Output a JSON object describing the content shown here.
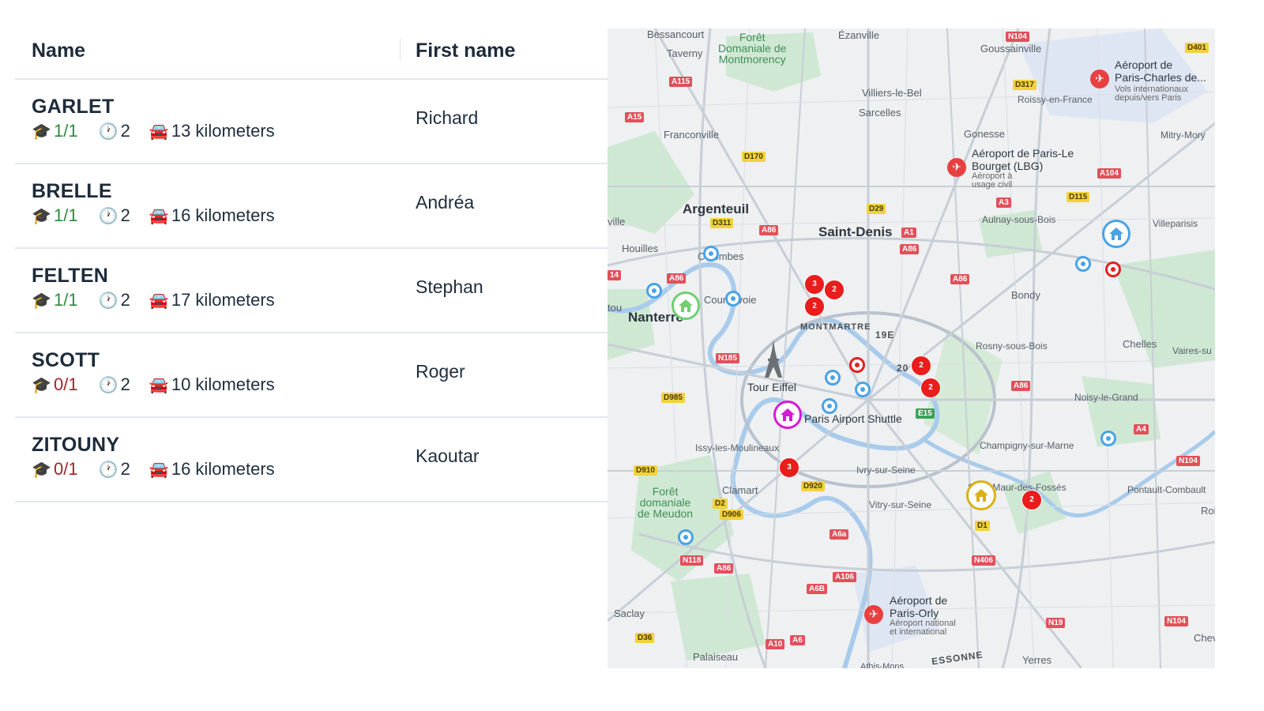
{
  "table": {
    "headers": {
      "name": "Name",
      "first_name": "First name"
    },
    "icons": {
      "grade": "graduation-cap-icon",
      "wait": "clock-icon",
      "distance": "car-icon"
    },
    "rows": [
      {
        "last_name": "GARLET",
        "first_name": "Richard",
        "grade": "1/1",
        "grade_status": "ok",
        "wait": "2",
        "distance": "13 kilometers"
      },
      {
        "last_name": "BRELLE",
        "first_name": "Andréa",
        "grade": "1/1",
        "grade_status": "ok",
        "wait": "2",
        "distance": "16 kilometers"
      },
      {
        "last_name": "FELTEN",
        "first_name": "Stephan",
        "grade": "1/1",
        "grade_status": "ok",
        "wait": "2",
        "distance": "17 kilometers"
      },
      {
        "last_name": "SCOTT",
        "first_name": "Roger",
        "grade": "0/1",
        "grade_status": "ko",
        "wait": "2",
        "distance": "10 kilometers"
      },
      {
        "last_name": "ZITOUNY",
        "first_name": "Kaoutar",
        "grade": "0/1",
        "grade_status": "ko",
        "wait": "2",
        "distance": "16 kilometers"
      }
    ],
    "colors": {
      "ok": "#2f8a3c",
      "ko": "#a0252b"
    }
  },
  "map": {
    "places": {
      "bessancourt": "Bessancourt",
      "taverny": "Taverny",
      "foret_montmorency": "Forêt\nDomaniale de\nMontmorency",
      "ezanville": "Ézanville",
      "goussainville": "Goussainville",
      "cdg": "Aéroport de\nParis-Charles de...",
      "cdg_sub": "Vols internationaux\ndepuis/vers Paris",
      "roissy": "Roissy-en-France",
      "villiers": "Villiers-le-Bel",
      "sarcelles": "Sarcelles",
      "franconville": "Franconville",
      "gonesse": "Gonesse",
      "mitry": "Mitry-Mory",
      "bourget": "Aéroport de Paris-Le\nBourget (LBG)",
      "bourget_sub": "Aéroport à\nusage civil",
      "argenteuil": "Argenteuil",
      "saint_denis": "Saint-Denis",
      "aulnay": "Aulnay-sous-Bois",
      "villeparisis": "Villeparisis",
      "ville": "ville",
      "houilles": "Houilles",
      "colombes": "Colombes",
      "courbevoie": "Courbevoie",
      "nanterre": "Nanterre",
      "montmartre": "MONTMARTRE",
      "19e": "19E",
      "bondy": "Bondy",
      "tou": "tou",
      "rosny": "Rosny-sous-Bois",
      "chelles": "Chelles",
      "vaires": "Vaires-su",
      "tour_eiffel": "Tour Eiffel",
      "20e": "20",
      "noisy": "Noisy-le-Grand",
      "shuttle": "Paris Airport Shuttle",
      "issy": "Issy-les-Moulineaux",
      "champigny": "Champigny-sur-Marne",
      "ivry": "Ivry-sur-Seine",
      "clamart": "Clamart",
      "saint_maur": "Saint-Maur-des-Fossés",
      "pontault": "Pontault-Combault",
      "meudon": "Forêt\ndomaniale\nde Meudon",
      "vitry": "Vitry-sur-Seine",
      "roi": "Roi",
      "orly": "Aéroport de\nParis-Orly",
      "orly_sub": "Aéroport national\net international",
      "saclay": "Saclay",
      "chev": "Chev",
      "palaiseau": "Palaiseau",
      "essonne": "ESSONNE",
      "yerres": "Yerres",
      "athis": "Athis-Mons"
    },
    "roads": {
      "n104a": "N104",
      "d401": "D401",
      "a115": "A115",
      "d317": "D317",
      "a15": "A15",
      "d170": "D170",
      "a104": "A104",
      "d115": "D115",
      "d29": "D29",
      "a3": "A3",
      "d311": "D311",
      "a86a": "A86",
      "a1": "A1",
      "a86b": "A86",
      "a14": "14",
      "a86c": "A86",
      "a86d": "A86",
      "n185": "N185",
      "a86e": "A86",
      "d985": "D985",
      "e15": "E15",
      "a4": "A4",
      "n104b": "N104",
      "d910": "D910",
      "d920": "D920",
      "d2": "D2",
      "d906": "D906",
      "d1": "D1",
      "a6a": "A6a",
      "n406": "N406",
      "n118": "N118",
      "a86f": "A86",
      "a106": "A106",
      "a6b": "A6B",
      "d36": "D36",
      "a10": "A10",
      "a6": "A6",
      "n19": "N19",
      "n104c": "N104"
    },
    "clusters": [
      "3",
      "2",
      "2",
      "2",
      "2",
      "3",
      "2"
    ],
    "marker_colors": {
      "cluster": "#ea1c1c",
      "target": "#e52020",
      "ring": "#4aa3e6",
      "home_green": "#6fcf73",
      "home_magenta": "#d61ad6",
      "home_gold": "#d9b112",
      "home_blue": "#4aa3e6"
    }
  }
}
